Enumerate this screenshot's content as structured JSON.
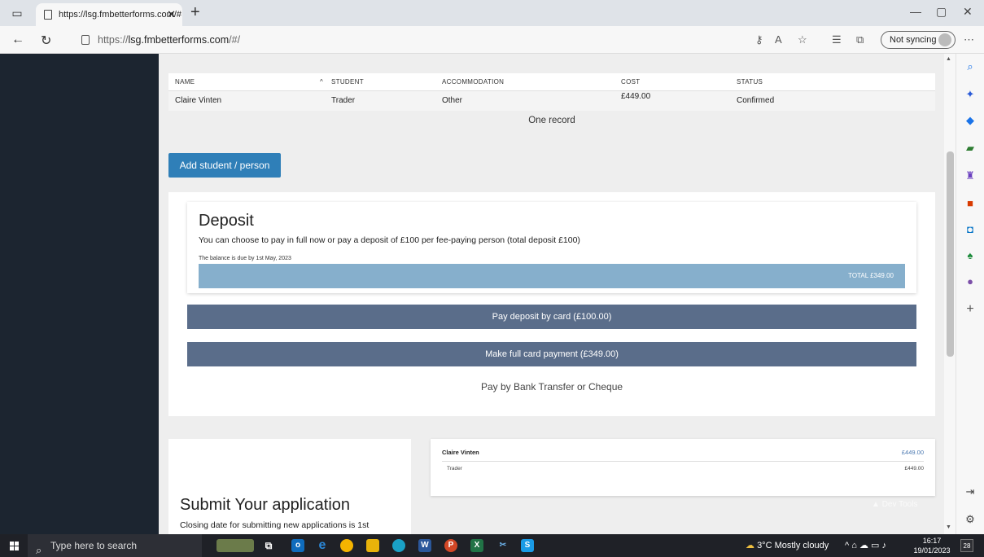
{
  "browser": {
    "tab_title": "https://lsg.fmbetterforms.com/#",
    "url_prefix": "https://",
    "url_host": "lsg.fmbetterforms.com",
    "url_path": "/#/",
    "sync_label": "Not syncing"
  },
  "table": {
    "headers": [
      "NAME",
      "STUDENT",
      "ACCOMMODATION",
      "COST",
      "STATUS"
    ],
    "rows": [
      [
        "Claire Vinten",
        "Trader",
        "Other",
        "£449.00",
        "Confirmed"
      ]
    ],
    "record_count": "One record"
  },
  "add_button": "Add student / person",
  "deposit": {
    "title": "Deposit",
    "description": "You can choose to pay in full now or pay a deposit of £100 per fee-paying person (total deposit £100)",
    "due": "The balance is due by 1st May, 2023",
    "total": "TOTAL £349.00",
    "pay_deposit": "Pay deposit by card (£100.00)",
    "pay_full": "Make full card payment (£349.00)",
    "bank": "Pay by Bank Transfer or Cheque"
  },
  "submit": {
    "title": "Submit Your application",
    "note": "Closing date for submitting new applications is 1st"
  },
  "summary": {
    "name": "Claire Vinten",
    "total": "£449.00",
    "type": "Trader",
    "cost": "£449.00"
  },
  "devtools": "Dev Tools",
  "taskbar": {
    "search_placeholder": "Type here to search",
    "weather": "3°C  Mostly cloudy",
    "time": "16:17",
    "date": "19/01/2023",
    "notifications": "28"
  },
  "colors": {
    "add_button": "#2f7fb8",
    "pay_button": "#5a6d8a",
    "total_bar": "#86afcc",
    "left_band": "#1c2530"
  }
}
